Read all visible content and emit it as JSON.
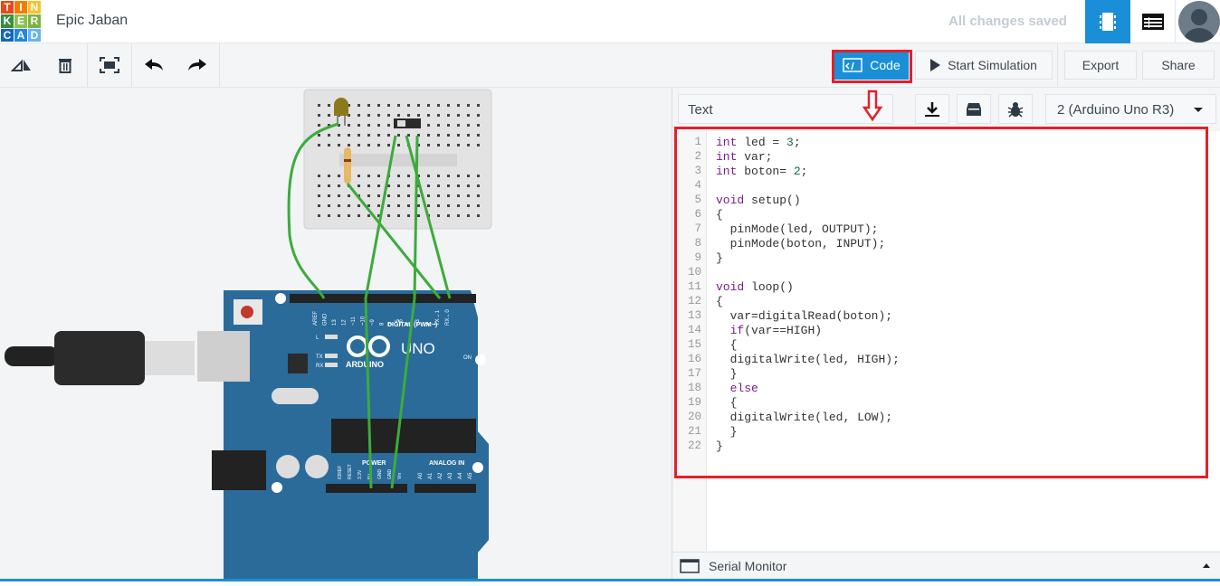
{
  "header": {
    "logo_letters": [
      "T",
      "I",
      "N",
      "K",
      "E",
      "R",
      "C",
      "A",
      "D"
    ],
    "logo_colors": [
      "#e64a19",
      "#f57c00",
      "#fbc02d",
      "#388e3c",
      "#8bc34a",
      "#7cb342",
      "#1565c0",
      "#1e88e5",
      "#64b5f6"
    ],
    "title": "Epic Jaban",
    "save_status": "All changes saved",
    "accent": "#1a8fd8"
  },
  "toolbar": {
    "code_label": "Code",
    "simulate_label": "Start Simulation",
    "export_label": "Export",
    "share_label": "Share"
  },
  "panel": {
    "mode": "Text",
    "device": "2 (Arduino Uno R3)",
    "serial_monitor": "Serial Monitor",
    "code_lines": [
      "int led = 3;",
      "int var;",
      "int boton= 2;",
      "",
      "void setup()",
      "{",
      "  pinMode(led, OUTPUT);",
      "  pinMode(boton, INPUT);",
      "}",
      "",
      "void loop()",
      "{",
      "  var=digitalRead(boton);",
      "  if(var==HIGH)",
      "  {",
      "  digitalWrite(led, HIGH);",
      "  }",
      "  else",
      "  {",
      "  digitalWrite(led, LOW);",
      "  }",
      "}"
    ]
  },
  "board": {
    "brand": "ARDUINO",
    "model": "UNO",
    "digital_label": "DIGITAL (PWM~)",
    "power_label": "POWER",
    "analog_label": "ANALOG IN",
    "on_label": "ON",
    "digital_pins": [
      "AREF",
      "GND",
      "13",
      "12",
      "~11",
      "~10",
      "~9",
      "8",
      "7",
      "~6",
      "~5",
      "4",
      "~3",
      "2",
      "TX→1",
      "RX←0"
    ],
    "power_pins": [
      "IOREF",
      "RESET",
      "3.3V",
      "5V",
      "GND",
      "GND",
      "Vin"
    ],
    "analog_pins": [
      "A0",
      "A1",
      "A2",
      "A3",
      "A4",
      "A5"
    ],
    "led_labels": [
      "L",
      "TX",
      "RX"
    ]
  }
}
